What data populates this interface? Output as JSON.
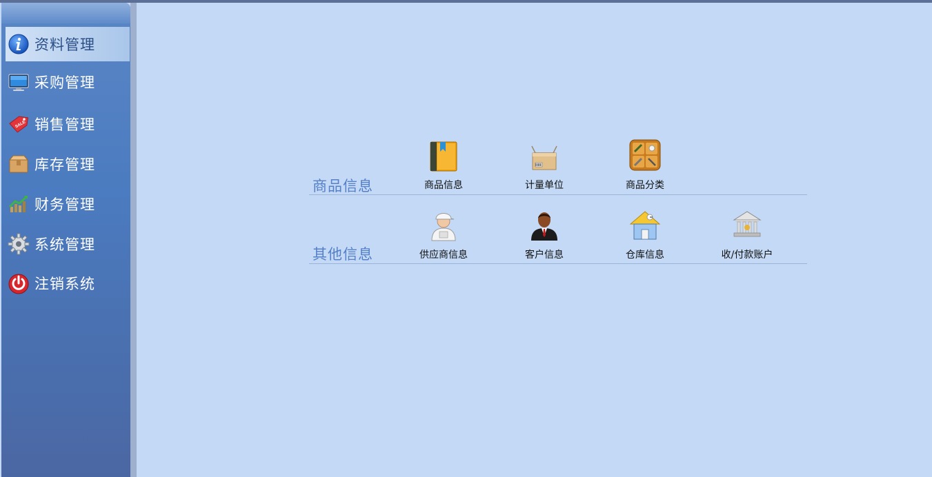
{
  "sidebar": {
    "items": [
      {
        "label": "资料管理",
        "icon": "info-icon",
        "active": true
      },
      {
        "label": "采购管理",
        "icon": "monitor-icon"
      },
      {
        "label": "销售管理",
        "icon": "sale-tag-icon"
      },
      {
        "label": "库存管理",
        "icon": "box-icon"
      },
      {
        "label": "财务管理",
        "icon": "growth-chart-icon"
      },
      {
        "label": "系统管理",
        "icon": "gear-icon"
      },
      {
        "label": "注销系统",
        "icon": "power-icon"
      }
    ]
  },
  "sections": [
    {
      "title": "商品信息",
      "tiles": [
        {
          "label": "商品信息",
          "icon": "book-icon"
        },
        {
          "label": "计量单位",
          "icon": "barcode-box-icon"
        },
        {
          "label": "商品分类",
          "icon": "toolbox-icon"
        }
      ]
    },
    {
      "title": "其他信息",
      "tiles": [
        {
          "label": "供应商信息",
          "icon": "supplier-worker-icon"
        },
        {
          "label": "客户信息",
          "icon": "customer-person-icon"
        },
        {
          "label": "仓库信息",
          "icon": "warehouse-house-icon"
        },
        {
          "label": "收/付款账户",
          "icon": "bank-icon"
        }
      ]
    }
  ],
  "colors": {
    "content_bg": "#c4d9f5",
    "sidebar_bg": "#4b7bc0",
    "section_title": "#5580c8"
  }
}
